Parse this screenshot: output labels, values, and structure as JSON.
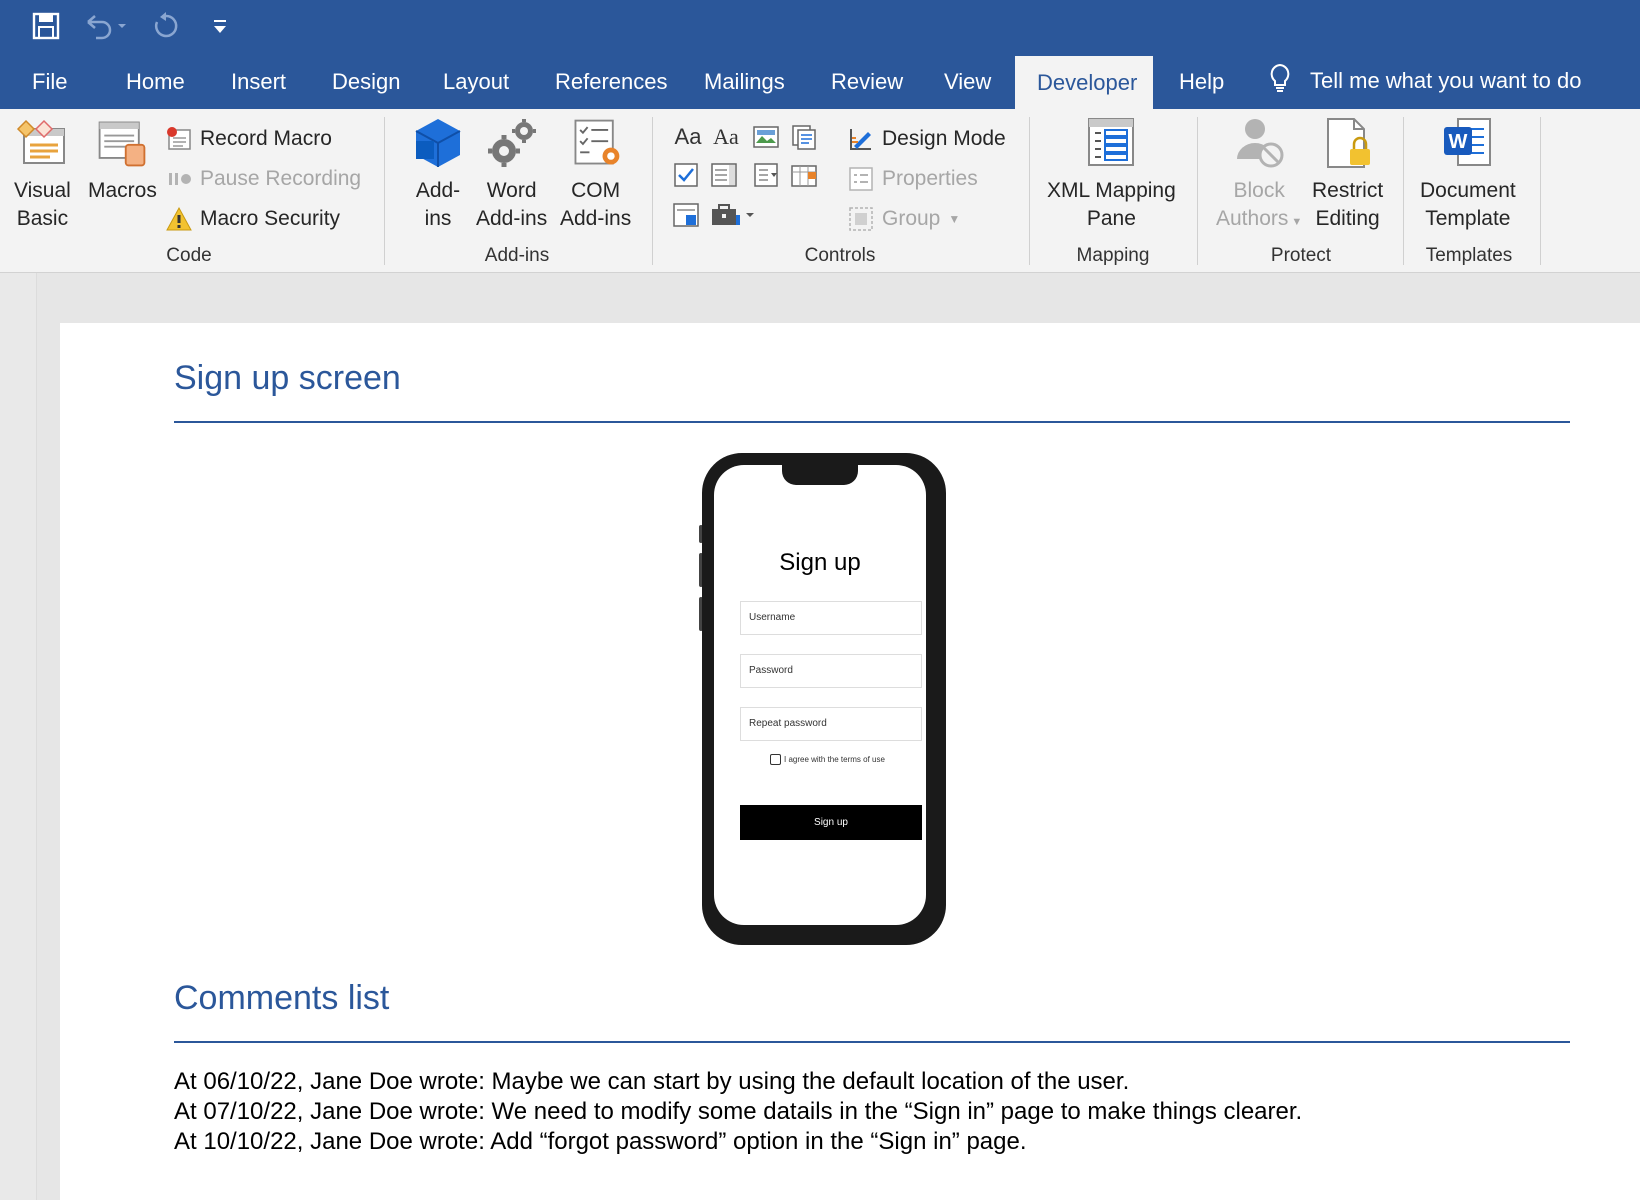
{
  "quick_access": {
    "save": "save-icon",
    "undo": "undo-icon",
    "redo": "redo-icon",
    "customize": "customize-qat-icon"
  },
  "tabs": [
    {
      "label": "File"
    },
    {
      "label": "Home"
    },
    {
      "label": "Insert"
    },
    {
      "label": "Design"
    },
    {
      "label": "Layout"
    },
    {
      "label": "References"
    },
    {
      "label": "Mailings"
    },
    {
      "label": "Review"
    },
    {
      "label": "View"
    },
    {
      "label": "Developer",
      "active": true
    },
    {
      "label": "Help"
    }
  ],
  "tell_me": "Tell me what you want to do",
  "ribbon": {
    "code": {
      "label": "Code",
      "visual_basic": {
        "line1": "Visual",
        "line2": "Basic"
      },
      "macros": "Macros",
      "record_macro": "Record Macro",
      "pause_recording": "Pause Recording",
      "macro_security": "Macro Security"
    },
    "addins": {
      "label": "Add-ins",
      "addins": {
        "line1": "Add-",
        "line2": "ins"
      },
      "word_addins": {
        "line1": "Word",
        "line2": "Add-ins"
      },
      "com_addins": {
        "line1": "COM",
        "line2": "Add-ins"
      }
    },
    "controls": {
      "label": "Controls",
      "design_mode": "Design Mode",
      "properties": "Properties",
      "group": "Group"
    },
    "mapping": {
      "label": "Mapping",
      "xml_mapping": {
        "line1": "XML Mapping",
        "line2": "Pane"
      }
    },
    "protect": {
      "label": "Protect",
      "block_authors": {
        "line1": "Block",
        "line2": "Authors"
      },
      "restrict_editing": {
        "line1": "Restrict",
        "line2": "Editing"
      }
    },
    "templates": {
      "label": "Templates",
      "document_template": {
        "line1": "Document",
        "line2": "Template"
      }
    }
  },
  "document": {
    "heading1": "Sign up screen",
    "heading2": "Comments list",
    "phone": {
      "title": "Sign up",
      "username": "Username",
      "password": "Password",
      "repeat_password": "Repeat password",
      "agree": "I agree with the terms of use",
      "button": "Sign up"
    },
    "comments": [
      "At 06/10/22, Jane Doe wrote: Maybe we can start by using the default location of the user.",
      "At 07/10/22, Jane Doe wrote: We need to modify some datails in the “Sign in” page to make things clearer.",
      "At 10/10/22, Jane Doe wrote: Add “forgot password” option in the “Sign in” page."
    ]
  },
  "colors": {
    "brand": "#2b579a",
    "ribbon": "#f3f3f3",
    "heading": "#2b579a"
  }
}
